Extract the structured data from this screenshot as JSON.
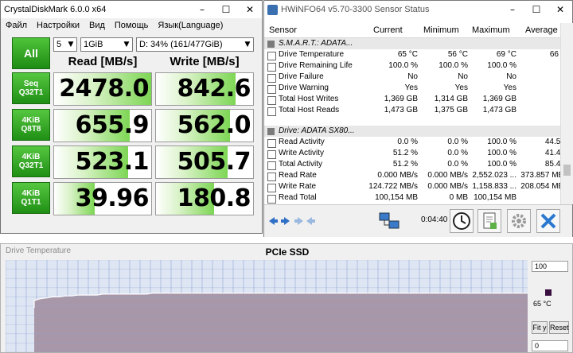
{
  "cdm": {
    "title": "CrystalDiskMark 6.0.0 x64",
    "menu": [
      "Файл",
      "Настройки",
      "Вид",
      "Помощь",
      "Язык(Language)"
    ],
    "count": "5",
    "size": "1GiB",
    "drive": "D: 34% (161/477GiB)",
    "all_label": "All",
    "read_header": "Read [MB/s]",
    "write_header": "Write [MB/s]",
    "tests": [
      {
        "line1": "Seq",
        "line2": "Q32T1",
        "read": "2478.0",
        "write": "842.6",
        "read_level": 1.0,
        "write_level": 0.82
      },
      {
        "line1": "4KiB",
        "line2": "Q8T8",
        "read": "655.9",
        "write": "562.0",
        "read_level": 0.78,
        "write_level": 0.76
      },
      {
        "line1": "4KiB",
        "line2": "Q32T1",
        "read": "523.1",
        "write": "505.7",
        "read_level": 0.76,
        "write_level": 0.74
      },
      {
        "line1": "4KiB",
        "line2": "Q1T1",
        "read": "39.96",
        "write": "180.8",
        "read_level": 0.42,
        "write_level": 0.6
      }
    ]
  },
  "hw": {
    "title": "HWiNFO64 v5.70-3300 Sensor Status",
    "columns": [
      "Sensor",
      "Current",
      "Minimum",
      "Maximum",
      "Average"
    ],
    "group1": "S.M.A.R.T.: ADATA...",
    "rows1": [
      {
        "name": "Drive Temperature",
        "cur": "65 °C",
        "min": "56 °C",
        "max": "69 °C",
        "avg": "66 °C"
      },
      {
        "name": "Drive Remaining Life",
        "cur": "100.0 %",
        "min": "100.0 %",
        "max": "100.0 %",
        "avg": ""
      },
      {
        "name": "Drive Failure",
        "cur": "No",
        "min": "No",
        "max": "No",
        "avg": ""
      },
      {
        "name": "Drive Warning",
        "cur": "Yes",
        "min": "Yes",
        "max": "Yes",
        "avg": ""
      },
      {
        "name": "Total Host Writes",
        "cur": "1,369 GB",
        "min": "1,314 GB",
        "max": "1,369 GB",
        "avg": ""
      },
      {
        "name": "Total Host Reads",
        "cur": "1,473 GB",
        "min": "1,375 GB",
        "max": "1,473 GB",
        "avg": ""
      }
    ],
    "group2": "Drive: ADATA SX80...",
    "rows2": [
      {
        "name": "Read Activity",
        "cur": "0.0 %",
        "min": "0.0 %",
        "max": "100.0 %",
        "avg": "44.5 %"
      },
      {
        "name": "Write Activity",
        "cur": "51.2 %",
        "min": "0.0 %",
        "max": "100.0 %",
        "avg": "41.4 %"
      },
      {
        "name": "Total Activity",
        "cur": "51.2 %",
        "min": "0.0 %",
        "max": "100.0 %",
        "avg": "85.4 %"
      },
      {
        "name": "Read Rate",
        "cur": "0.000 MB/s",
        "min": "0.000 MB/s",
        "max": "2,552.023 ...",
        "avg": "373.857 MB/s"
      },
      {
        "name": "Write Rate",
        "cur": "124.722 MB/s",
        "min": "0.000 MB/s",
        "max": "1,158.833 ...",
        "avg": "208.054 MB/s"
      },
      {
        "name": "Read Total",
        "cur": "100,154 MB",
        "min": "0 MB",
        "max": "100,154 MB",
        "avg": ""
      }
    ],
    "timer": "0:04:40"
  },
  "graph": {
    "window_title": "Drive Temperature",
    "caption": "PCIe SSD",
    "max_label": "100",
    "current_label": "65 °C",
    "min_label": "0",
    "fit_label": "Fit y",
    "reset_label": "Reset",
    "fill_color": "#a797a8",
    "line_color": "#ffffff",
    "grid_color": "#8fa6d6",
    "bg_color": "#dfe6f3",
    "y_max": 100,
    "y_min": 0,
    "start_value": 48,
    "temps": [
      56,
      58,
      59,
      60,
      60,
      61,
      61,
      62,
      62,
      62,
      62,
      63,
      63,
      63,
      63,
      63,
      63,
      63,
      63,
      64,
      64,
      64,
      64,
      64,
      64,
      64,
      64,
      64,
      64,
      64,
      64,
      64,
      64,
      64,
      64,
      64,
      64,
      64,
      64,
      64,
      64,
      64,
      64,
      64,
      64,
      64,
      64,
      64,
      64,
      64,
      64,
      64,
      64,
      64,
      64,
      64,
      64,
      64,
      64,
      64,
      64,
      64,
      64,
      64,
      64,
      64,
      64,
      64,
      64,
      64,
      64,
      64,
      64,
      64,
      64,
      64,
      64,
      64,
      64,
      64
    ]
  }
}
